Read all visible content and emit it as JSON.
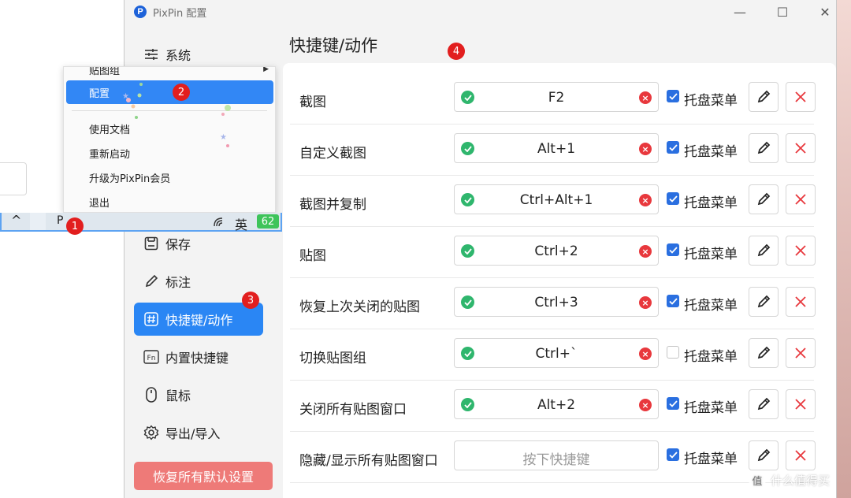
{
  "app": {
    "logo_letter": "P",
    "title": "PixPin 配置"
  },
  "window_controls": {
    "minimize": "—",
    "maximize": "☐",
    "close": "✕"
  },
  "sidebar": {
    "items": [
      {
        "label": "系统",
        "icon": "sliders-icon"
      },
      {
        "label": "保存",
        "icon": "save-icon"
      },
      {
        "label": "标注",
        "icon": "pencil-icon"
      },
      {
        "label": "快捷键/动作",
        "icon": "hash-icon",
        "active": true
      },
      {
        "label": "内置快捷键",
        "icon": "fn-key-icon"
      },
      {
        "label": "鼠标",
        "icon": "mouse-icon"
      },
      {
        "label": "导出/导入",
        "icon": "gear-icon"
      }
    ],
    "reset_label": "恢复所有默认设置"
  },
  "main": {
    "title": "快捷键/动作",
    "rows": [
      {
        "label": "截图",
        "hotkey": "F2",
        "set": true,
        "tray": true
      },
      {
        "label": "自定义截图",
        "hotkey": "Alt+1",
        "set": true,
        "tray": true
      },
      {
        "label": "截图并复制",
        "hotkey": "Ctrl+Alt+1",
        "set": true,
        "tray": true
      },
      {
        "label": "贴图",
        "hotkey": "Ctrl+2",
        "set": true,
        "tray": true
      },
      {
        "label": "恢复上次关闭的贴图",
        "hotkey": "Ctrl+3",
        "set": true,
        "tray": true
      },
      {
        "label": "切换贴图组",
        "hotkey": "Ctrl+`",
        "set": true,
        "tray": false
      },
      {
        "label": "关闭所有贴图窗口",
        "hotkey": "Alt+2",
        "set": true,
        "tray": true
      },
      {
        "label": "隐藏/显示所有贴图窗口",
        "hotkey": "",
        "placeholder": "按下快捷键",
        "set": false,
        "tray": true
      }
    ],
    "tray_label": "托盘菜单"
  },
  "tray_menu": {
    "items": [
      "贴图组",
      "配置",
      "使用文档",
      "重新启动",
      "升级为PixPin会员",
      "退出"
    ],
    "selected": "配置"
  },
  "taskbar": {
    "chevron": "^",
    "ime": "英",
    "battery": "62"
  },
  "markers": [
    "1",
    "2",
    "3",
    "4"
  ],
  "watermark": {
    "logo": "值",
    "text": "什么值得买"
  },
  "colors": {
    "accent": "#2a86f4",
    "danger": "#e8383d",
    "success": "#2fb66d",
    "reset": "#ee7a78"
  }
}
